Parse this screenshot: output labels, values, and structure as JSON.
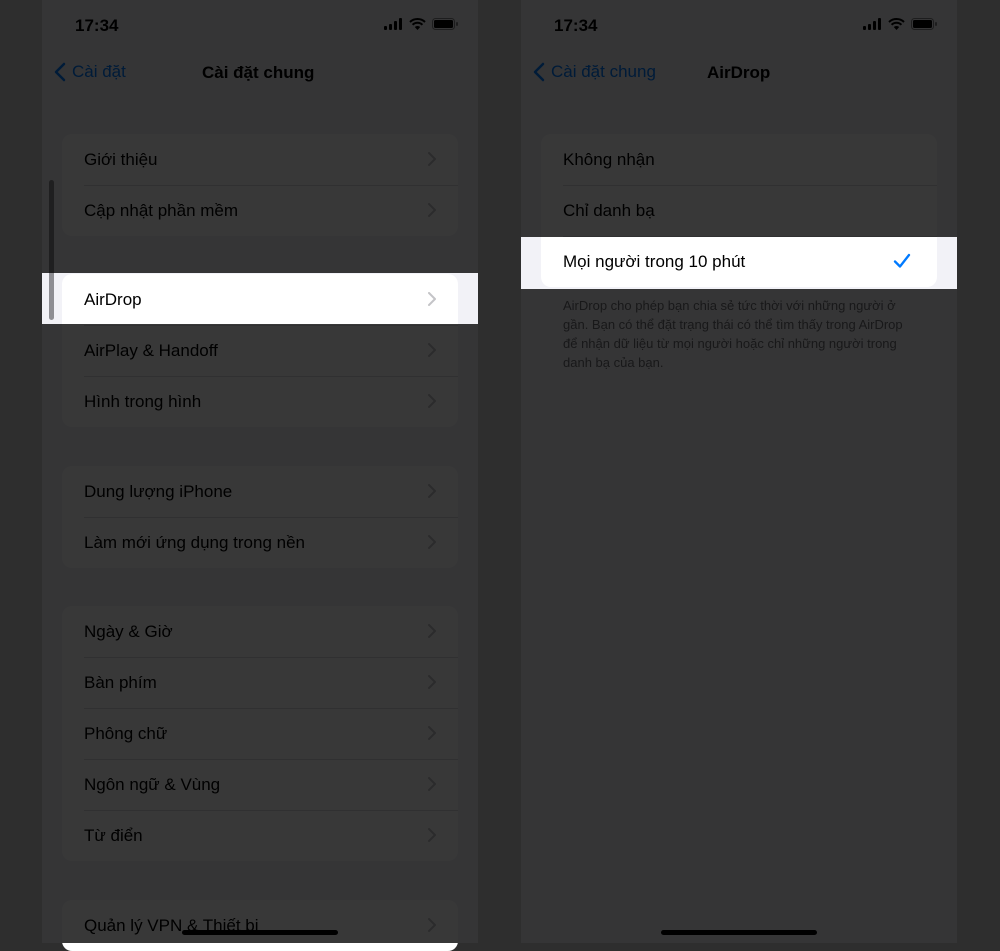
{
  "left": {
    "time": "17:34",
    "nav": {
      "back_label": "Cài đặt",
      "title": "Cài đặt chung"
    },
    "groups": [
      [
        "Giới thiệu",
        "Cập nhật phần mềm"
      ],
      [
        "AirDrop",
        "AirPlay & Handoff",
        "Hình trong hình"
      ],
      [
        "Dung lượng iPhone",
        "Làm mới ứng dụng trong nền"
      ],
      [
        "Ngày & Giờ",
        "Bàn phím",
        "Phông chữ",
        "Ngôn ngữ & Vùng",
        "Từ điển"
      ],
      [
        "Quản lý VPN & Thiết bị"
      ]
    ],
    "highlighted_item": "AirDrop"
  },
  "right": {
    "time": "17:34",
    "nav": {
      "back_label": "Cài đặt chung",
      "title": "AirDrop"
    },
    "options": [
      "Không nhận",
      "Chỉ danh bạ",
      "Mọi người trong 10 phút"
    ],
    "selected_option": "Mọi người trong 10 phút",
    "footer": "AirDrop cho phép bạn chia sẻ tức thời với những người ở gần. Bạn có thể đặt trạng thái có thể tìm thấy trong AirDrop để nhận dữ liệu từ mọi người hoặc chỉ những người trong danh bạ của bạn."
  },
  "colors": {
    "accent": "#007aff",
    "background": "#f2f2f7",
    "overlay": "rgba(0,0,0,0.78)"
  },
  "icons": [
    "chevron-left-icon",
    "chevron-right-icon",
    "checkmark-icon",
    "cellular-signal-icon",
    "wifi-icon",
    "battery-icon"
  ]
}
